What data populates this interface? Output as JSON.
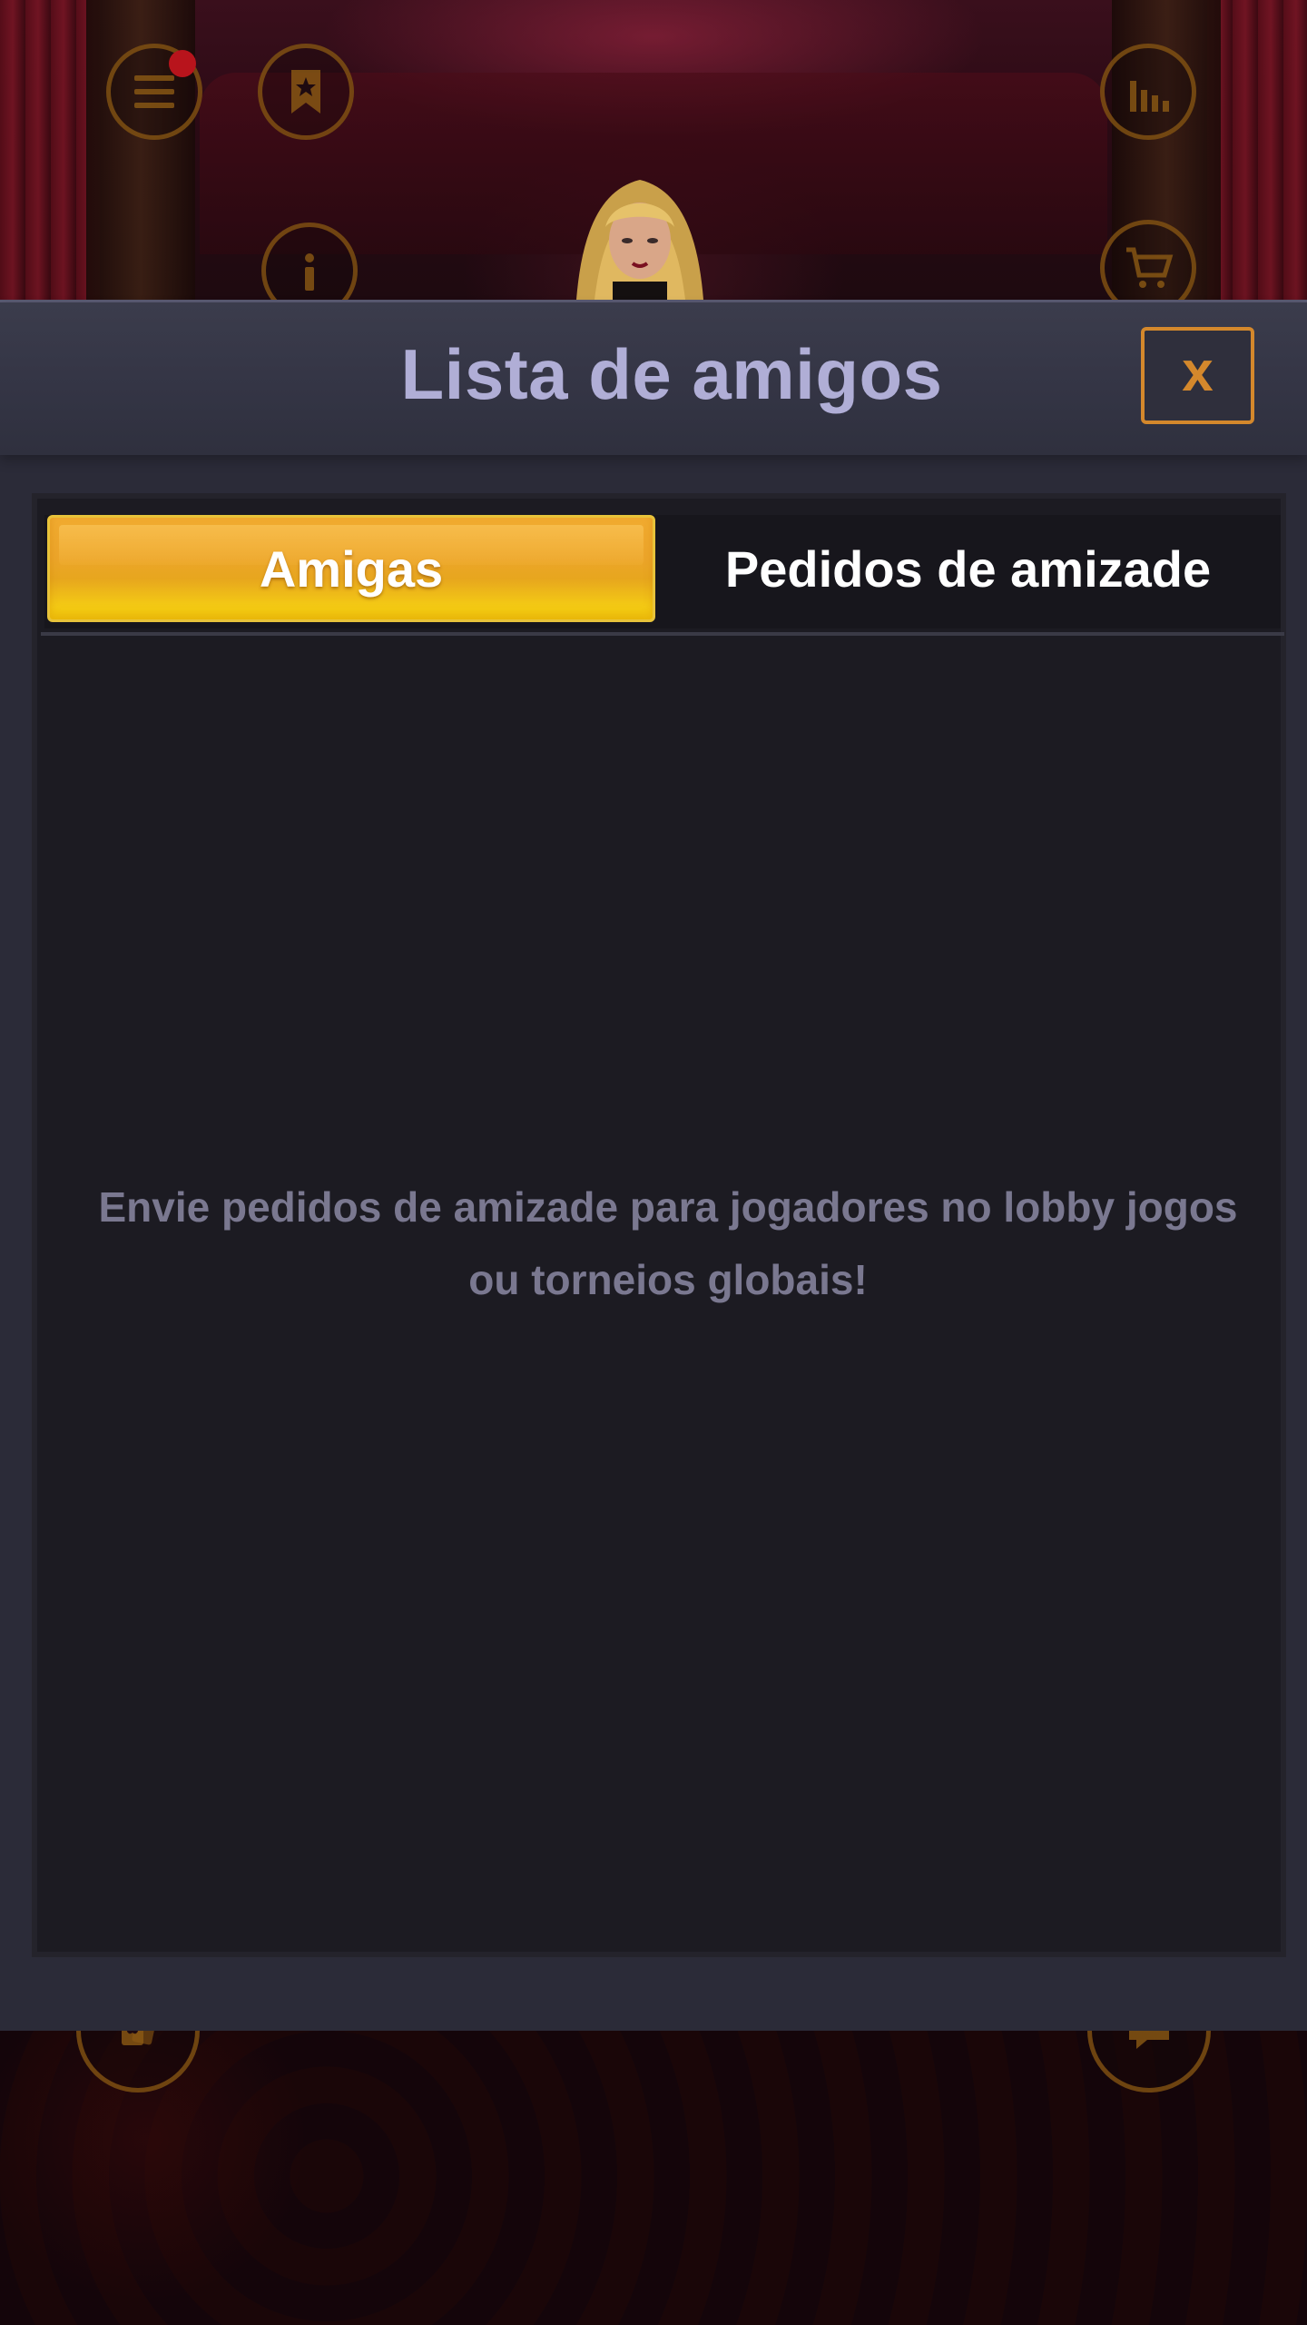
{
  "modal": {
    "title": "Lista de amigos",
    "close_label": "x"
  },
  "tabs": [
    {
      "label": "Amigas",
      "active": true
    },
    {
      "label": "Pedidos de amizade",
      "active": false
    }
  ],
  "empty_state": {
    "message": "Envie pedidos de amizade para jogadores no lobby jogos ou torneios globais!"
  },
  "background_hud": {
    "top_left": [
      "menu-icon",
      "bookmark-star-icon",
      "info-icon"
    ],
    "top_right": [
      "stats-icon",
      "cart-icon"
    ],
    "bottom_left": [
      "cards-icon"
    ],
    "bottom_right": [
      "chat-icon"
    ],
    "menu_has_notification": true
  },
  "colors": {
    "title": "#b0aed6",
    "close_accent": "#d4882c",
    "active_tab_gold": "#f1ab30",
    "message_text": "#7a7890",
    "modal_bg": "#2b2b38",
    "panel_bg": "#1c1b22"
  }
}
